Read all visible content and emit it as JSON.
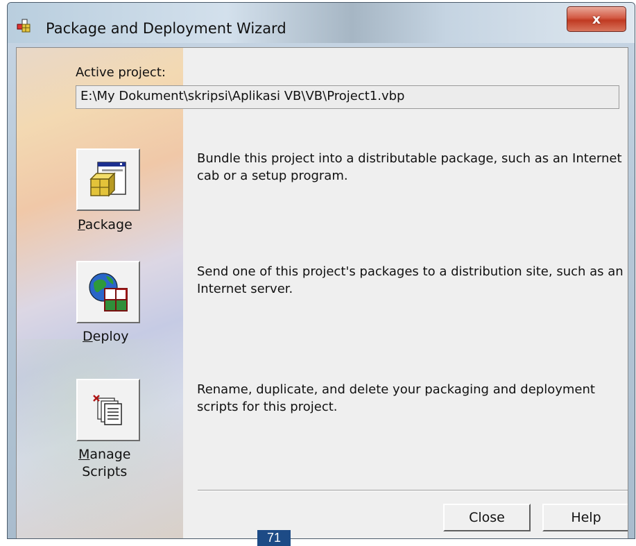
{
  "window": {
    "title": "Package and Deployment Wizard",
    "close_glyph": "x"
  },
  "active_project": {
    "label": "Active project:",
    "path": "E:\\My Dokument\\skripsi\\Aplikasi VB\\VB\\Project1.vbp"
  },
  "actions": [
    {
      "id": "package",
      "label": "Package",
      "mnemonic": "P",
      "icon": "package-icon",
      "description": "Bundle this project into a distributable package, such as an Internet cab or a setup program."
    },
    {
      "id": "deploy",
      "label": "Deploy",
      "mnemonic": "D",
      "icon": "globe-deploy-icon",
      "description": "Send one of this project's packages to a distribution site, such as an Internet server."
    },
    {
      "id": "manage_scripts",
      "label_line1": "Manage",
      "label_line2": "Scripts",
      "mnemonic": "M",
      "icon": "scripts-icon",
      "description": "Rename, duplicate, and delete your packaging and deployment scripts for this project."
    }
  ],
  "footer": {
    "close_label": "Close",
    "help_label": "Help"
  },
  "page_number": "71",
  "colors": {
    "close_button": "#c8452d",
    "page_badge": "#1d4b86",
    "client_bg": "#efefef"
  }
}
